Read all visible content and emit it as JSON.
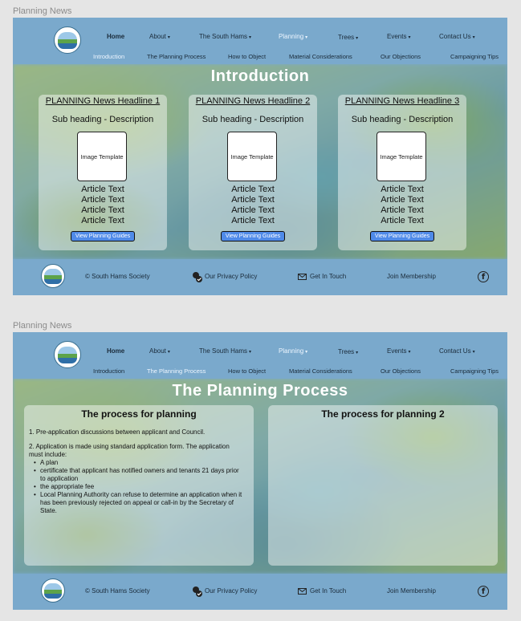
{
  "frames": [
    {
      "label": "Planning News",
      "nav": {
        "items": [
          "Home",
          "About",
          "The South Hams",
          "Planning",
          "Trees",
          "Events",
          "Contact Us"
        ],
        "subitems": [
          "Introduction",
          "The Planning Process",
          "How to Object",
          "Material Considerations",
          "Our Objections",
          "Campaigning Tips"
        ]
      },
      "title": "Introduction",
      "cards": [
        {
          "headline": "PLANNING News Headline 1",
          "subheading": "Sub heading - Description",
          "image_text": "Image Template",
          "article_lines": [
            "Article Text",
            "Article Text",
            "Article Text",
            "Article Text"
          ],
          "button": "View Planning Guides"
        },
        {
          "headline": "PLANNING News Headline 2",
          "subheading": "Sub heading - Description",
          "image_text": "Image Template",
          "article_lines": [
            "Article Text",
            "Article Text",
            "Article Text",
            "Article Text"
          ],
          "button": "View Planning Guides"
        },
        {
          "headline": "PLANNING News Headline 3",
          "subheading": "Sub heading - Description",
          "image_text": "Image Template",
          "article_lines": [
            "Article Text",
            "Article Text",
            "Article Text",
            "Article Text"
          ],
          "button": "View Planning Guides"
        }
      ],
      "footer": {
        "copyright": "© South Hams Society",
        "privacy": "Our Privacy Policy",
        "contact": "Get In Touch",
        "membership": "Join Membership",
        "facebook_letter": "f"
      }
    },
    {
      "label": "Planning News",
      "nav": {
        "items": [
          "Home",
          "About",
          "The South Hams",
          "Planning",
          "Trees",
          "Events",
          "Contact Us"
        ],
        "subitems": [
          "Introduction",
          "The Planning Process",
          "How to Object",
          "Material Considerations",
          "Our Objections",
          "Campaigning Tips"
        ]
      },
      "title": "The Planning Process",
      "panels": [
        {
          "heading": "The process for planning",
          "step1": "1.  Pre-application discussions between applicant and Council.",
          "step2": "2.  Application is made using standard application form. The application must include:",
          "bullets": [
            "A plan",
            "certificate that applicant has notified owners and tenants 21 days prior to application",
            "the appropriate fee",
            "Local Planning Authority can refuse to determine an application when it has been previously rejected on appeal or call-in by the Secretary of State."
          ]
        },
        {
          "heading": "The process for planning 2"
        }
      ],
      "footer": {
        "copyright": "© South Hams Society",
        "privacy": "Our Privacy Policy",
        "contact": "Get In Touch",
        "membership": "Join Membership",
        "facebook_letter": "f"
      }
    }
  ],
  "colors": {
    "frame_bg": "#7aa9cc",
    "button_bg": "#4f8ae8",
    "active_nav": "#eef6ff"
  },
  "icons": [
    "logo-icon",
    "caret-down-icon",
    "privacy-icon",
    "mail-icon",
    "facebook-icon"
  ]
}
